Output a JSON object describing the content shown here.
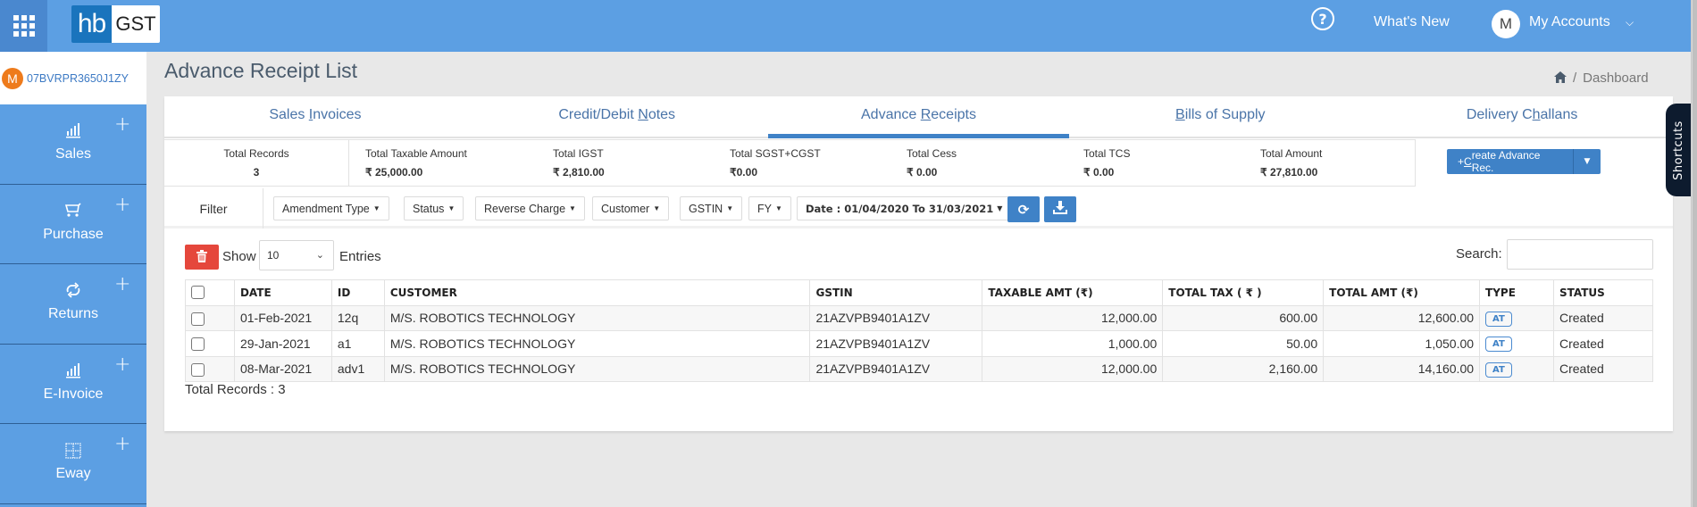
{
  "header": {
    "logo_left": "hb",
    "logo_right": "GST",
    "help_icon": "?",
    "whats_new": "What's New",
    "account_avatar": "M",
    "my_accounts": "My Accounts",
    "chevron": "⌵"
  },
  "sidebar": {
    "account_badge": "M",
    "account_id": "07BVRPR3650J1ZY",
    "items": [
      {
        "label": "Sales",
        "icon": "bar-chart-icon",
        "glyph": "📶"
      },
      {
        "label": "Purchase",
        "icon": "cart-icon",
        "glyph": "🛒"
      },
      {
        "label": "Returns",
        "icon": "repeat-icon",
        "glyph": "⟳"
      },
      {
        "label": "E-Invoice",
        "icon": "bar-chart-icon",
        "glyph": "📶"
      },
      {
        "label": "Eway",
        "icon": "grid-icon",
        "glyph": "⊞"
      }
    ],
    "plus": "+"
  },
  "page": {
    "title": "Advance Receipt List",
    "breadcrumb_sep": "/",
    "breadcrumb_current": "Dashboard"
  },
  "tabs": [
    {
      "pre": "Sales ",
      "key": "I",
      "post": "nvoices",
      "active": false
    },
    {
      "pre": "Credit/Debit ",
      "key": "N",
      "post": "otes",
      "active": false
    },
    {
      "pre": "Advance ",
      "key": "R",
      "post": "eceipts",
      "active": true
    },
    {
      "pre": "",
      "key": "B",
      "post": "ills of Supply",
      "active": false
    },
    {
      "pre": "Delivery C",
      "key": "h",
      "post": "allans",
      "active": false
    }
  ],
  "stats": [
    {
      "label": "Total Records",
      "value": "3"
    },
    {
      "label": "Total Taxable Amount",
      "value": "₹ 25,000.00"
    },
    {
      "label": "Total IGST",
      "value": "₹ 2,810.00"
    },
    {
      "label": "Total SGST+CGST",
      "value": "₹0.00"
    },
    {
      "label": "Total Cess",
      "value": "₹ 0.00"
    },
    {
      "label": "Total TCS",
      "value": "₹ 0.00"
    },
    {
      "label": "Total Amount",
      "value": "₹ 27,810.00"
    }
  ],
  "create_button": {
    "pre": "+ ",
    "key": "C",
    "post": "reate Advance Rec."
  },
  "filter": {
    "label": "Filter",
    "buttons": [
      "Amendment Type",
      "Status",
      "Reverse Charge",
      "Customer",
      "GSTIN",
      "FY"
    ],
    "date_range": "Date : 01/04/2020 To 31/03/2021",
    "refresh_icon": "⟳",
    "download_icon": "⤓"
  },
  "list_controls": {
    "show_label": "Show",
    "entries_value": "10",
    "entries_label": "Entries",
    "search_label": "Search:",
    "search_value": ""
  },
  "table": {
    "columns": [
      "DATE",
      "ID",
      "CUSTOMER",
      "GSTIN",
      "TAXABLE AMT (₹)",
      "TOTAL TAX ( ₹ )",
      "TOTAL AMT (₹)",
      "TYPE",
      "STATUS"
    ],
    "rows": [
      {
        "date": "01-Feb-2021",
        "id": "12q",
        "customer": "M/S. ROBOTICS TECHNOLOGY",
        "gstin": "21AZVPB9401A1ZV",
        "taxable": "12,000.00",
        "tax": "600.00",
        "total": "12,600.00",
        "type": "AT",
        "status": "Created"
      },
      {
        "date": "29-Jan-2021",
        "id": "a1",
        "customer": "M/S. ROBOTICS TECHNOLOGY",
        "gstin": "21AZVPB9401A1ZV",
        "taxable": "1,000.00",
        "tax": "50.00",
        "total": "1,050.00",
        "type": "AT",
        "status": "Created"
      },
      {
        "date": "08-Mar-2021",
        "id": "adv1",
        "customer": "M/S. ROBOTICS TECHNOLOGY",
        "gstin": "21AZVPB9401A1ZV",
        "taxable": "12,000.00",
        "tax": "2,160.00",
        "total": "14,160.00",
        "type": "AT",
        "status": "Created"
      }
    ]
  },
  "footer": {
    "total_records": "Total Records : 3"
  },
  "shortcuts": {
    "label": "Shortcuts"
  },
  "colors": {
    "header_blue": "#5c9fe3",
    "accent": "#3f82c7",
    "danger": "#e5473c",
    "badge_orange": "#ee7b1c"
  }
}
